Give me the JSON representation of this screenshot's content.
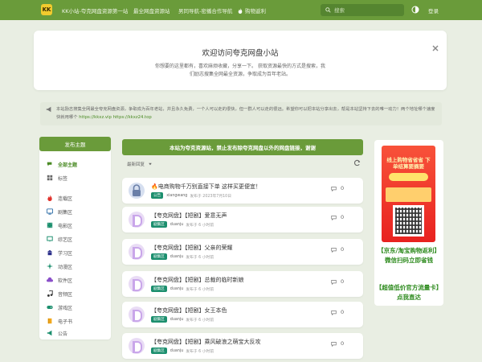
{
  "topbar": {
    "logo": "KK",
    "site_title": "KK小站-夸克网盘资源第一站",
    "nav": [
      "最全网盘资源站",
      "男同导航-密播合作导航",
      "购物返利"
    ],
    "search_placeholder": "搜索",
    "login": "登录"
  },
  "welcome": {
    "title": "欢迎访问夸克网盘小站",
    "text": "你想要的这里都有，喜欢麻烦收藏，分享一下。 获取资源最快的方式是搜索，我们励志搜集全网最全资源，争取成为百年老站。"
  },
  "notice": {
    "text": "本站励志搜集全网最全夸克网盘资源，争取成为百年老站，并且永久免费，一个人可以走的很快，但一群人可以走的很远。希望你可以把本站分享出去，帮是本站坚持下去的唯一动力！两个地址哪个速度快就用哪个",
    "link1": "https://kkxz.vip",
    "link2": "https://kkxz24.top"
  },
  "sidebar": {
    "post_button": "发布主题",
    "items": [
      "全部主题",
      "标签",
      "连载区",
      "剧集区",
      "电影区",
      "综艺区",
      "学习区",
      "动漫区",
      "软件区",
      "音频区",
      "游戏区",
      "电子书",
      "公告"
    ]
  },
  "feed": {
    "header": "本站为夸克资源站，禁止发布除夸克网盘以外的网盘链接，谢谢",
    "sort_label": "最新回复",
    "posts": [
      {
        "title": "电商购物千万别直接下单 这样买更便宜！",
        "tag": "公告",
        "user": "xiangwang",
        "time": "发布于 2023年7月10日",
        "replies": "0",
        "emoji": "🔥"
      },
      {
        "title": "【夸克网盘】【短剧】爱意无声",
        "tag": "剧集区",
        "user": "duanju",
        "time": "发布于 6 小时前",
        "replies": "0",
        "emoji": ""
      },
      {
        "title": "【夸克网盘】【短剧】父亲的荣耀",
        "tag": "剧集区",
        "user": "duanju",
        "time": "发布于 6 小时前",
        "replies": "0",
        "emoji": ""
      },
      {
        "title": "【夸克网盘】【短剧】总裁的临时新娘",
        "tag": "剧集区",
        "user": "duanju",
        "time": "发布于 6 小时前",
        "replies": "0",
        "emoji": ""
      },
      {
        "title": "【夸克网盘】【短剧】女王本色",
        "tag": "剧集区",
        "user": "duanju",
        "time": "发布于 6 小时前",
        "replies": "0",
        "emoji": ""
      },
      {
        "title": "【夸克网盘】【短剧】乘风破浪之萌宝大反攻",
        "tag": "剧集区",
        "user": "duanju",
        "time": "发布于 6 小时前",
        "replies": "0",
        "emoji": ""
      }
    ]
  },
  "ad": {
    "headline": "线上购物省省省 下单结算要摘要",
    "line1": "【京东/淘宝购物返利】",
    "line2": "微信扫码立即省钱",
    "line3": "【超值低价官方流量卡】",
    "line4": "点我直达"
  },
  "colors": {
    "accent": "#6a9b3a",
    "tag": "#1c8f6e",
    "ad_text": "#2e8b1e"
  }
}
